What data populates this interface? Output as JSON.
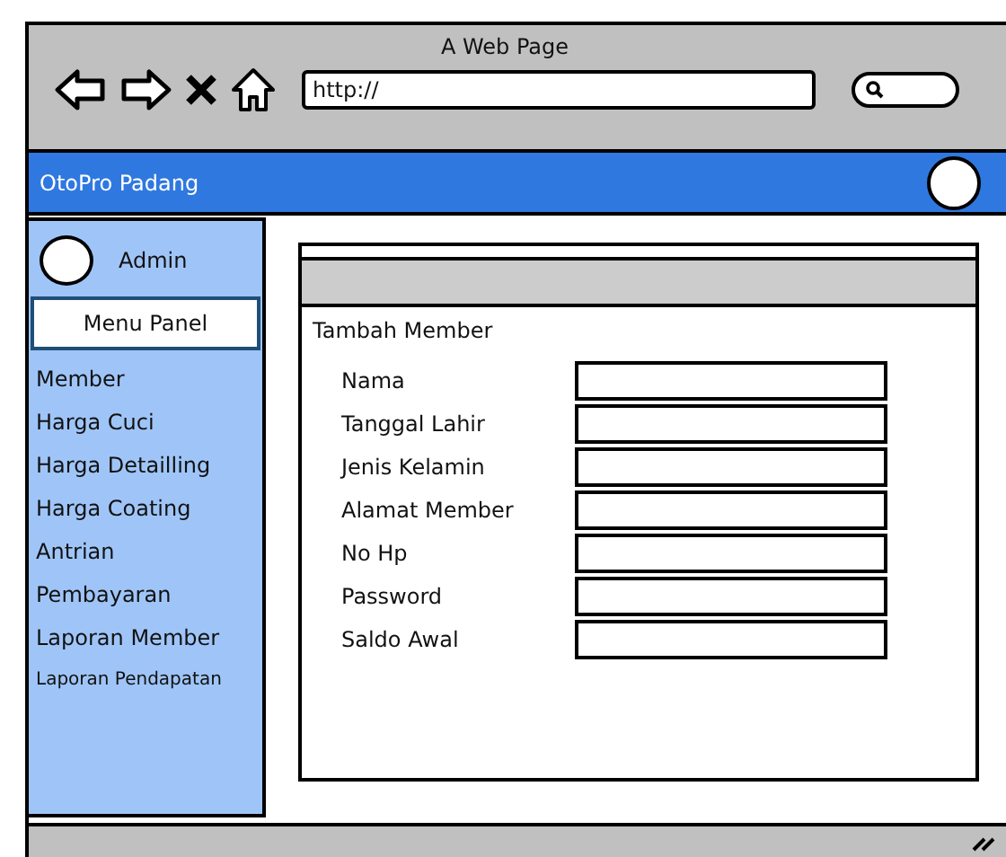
{
  "window": {
    "title": "A Web Page"
  },
  "browser": {
    "address": "http://"
  },
  "header": {
    "brand": "OtoPro Padang"
  },
  "sidebar": {
    "user": "Admin",
    "panel_title": "Menu Panel",
    "items": [
      {
        "label": "Member"
      },
      {
        "label": "Harga Cuci"
      },
      {
        "label": "Harga Detailling"
      },
      {
        "label": "Harga Coating"
      },
      {
        "label": "Antrian"
      },
      {
        "label": "Pembayaran"
      },
      {
        "label": "Laporan Member"
      },
      {
        "label": "Laporan Pendapatan"
      }
    ]
  },
  "form": {
    "title": "Tambah Member",
    "fields": [
      {
        "label": "Nama"
      },
      {
        "label": "Tanggal Lahir"
      },
      {
        "label": "Jenis Kelamin"
      },
      {
        "label": "Alamat Member"
      },
      {
        "label": "No Hp"
      },
      {
        "label": "Password"
      },
      {
        "label": "Saldo Awal"
      }
    ]
  }
}
